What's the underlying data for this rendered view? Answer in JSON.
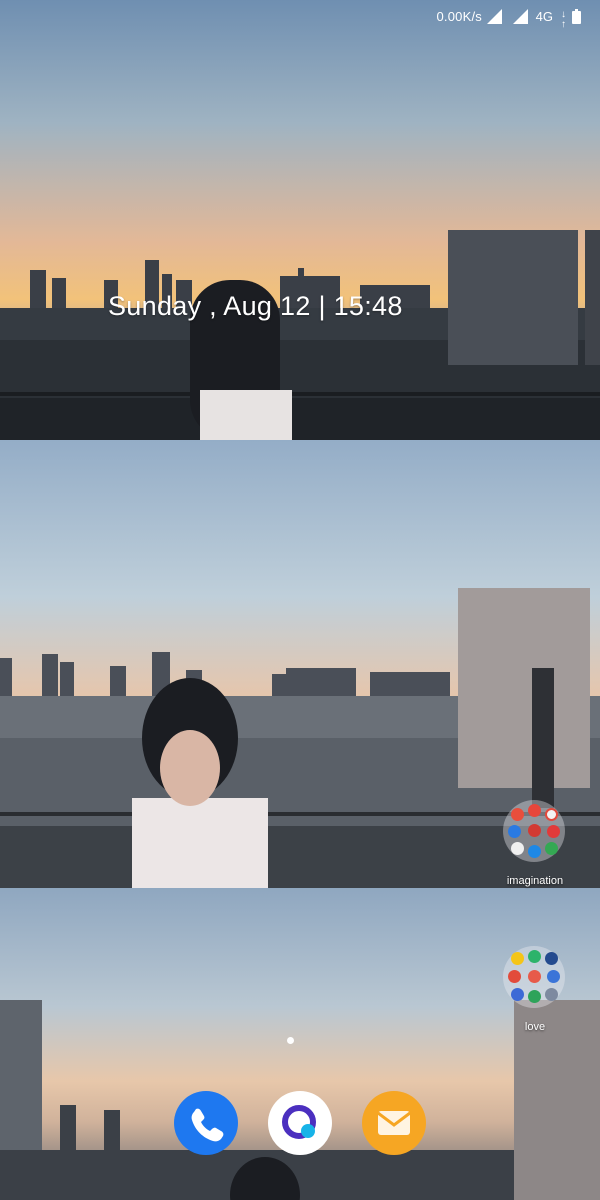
{
  "status_bar": {
    "net_speed": "0.00K/s",
    "network_type": "4G",
    "icons": [
      "signal-icon",
      "signal-icon",
      "data-arrows-icon",
      "battery-icon"
    ]
  },
  "lockscreen": {
    "date_time": "Sunday , Aug 12 | 15:48"
  },
  "folders": [
    {
      "name": "imagination",
      "icon": "folder-icon"
    },
    {
      "name": "love",
      "icon": "folder-icon"
    }
  ],
  "dock": [
    {
      "app": "Phone",
      "icon": "phone-icon",
      "color": "#1e78f0"
    },
    {
      "app": "Browser",
      "icon": "browser-icon",
      "color": "#ffffff"
    },
    {
      "app": "Messages",
      "icon": "message-icon",
      "color": "#f6a623"
    }
  ],
  "page_indicator": {
    "pages": 1,
    "current": 1
  }
}
